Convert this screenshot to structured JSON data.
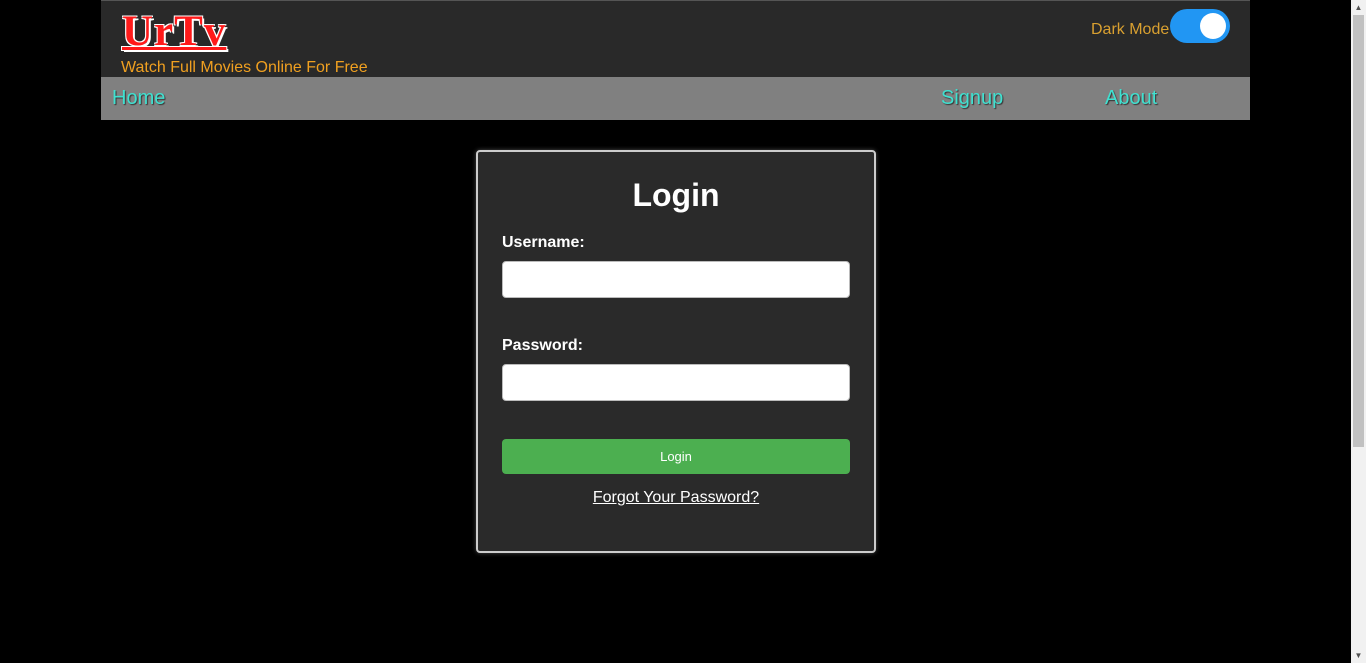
{
  "header": {
    "logo": "UrTv",
    "tagline": "Watch Full Movies Online For Free",
    "dark_mode_label": "Dark Mode",
    "dark_mode_on": true
  },
  "nav": {
    "home": "Home",
    "signup": "Signup",
    "about": "About"
  },
  "login": {
    "title": "Login",
    "username_label": "Username:",
    "username_value": "",
    "password_label": "Password:",
    "password_value": "",
    "submit_label": "Login",
    "forgot_label": "Forgot Your Password?"
  },
  "colors": {
    "logo": "#ff1a1a",
    "tagline": "#f0a020",
    "nav_link": "#40e0d0",
    "toggle_on": "#2196f3",
    "button": "#4caf50"
  },
  "icons": {
    "scroll_up": "▲",
    "scroll_down": "▼"
  }
}
